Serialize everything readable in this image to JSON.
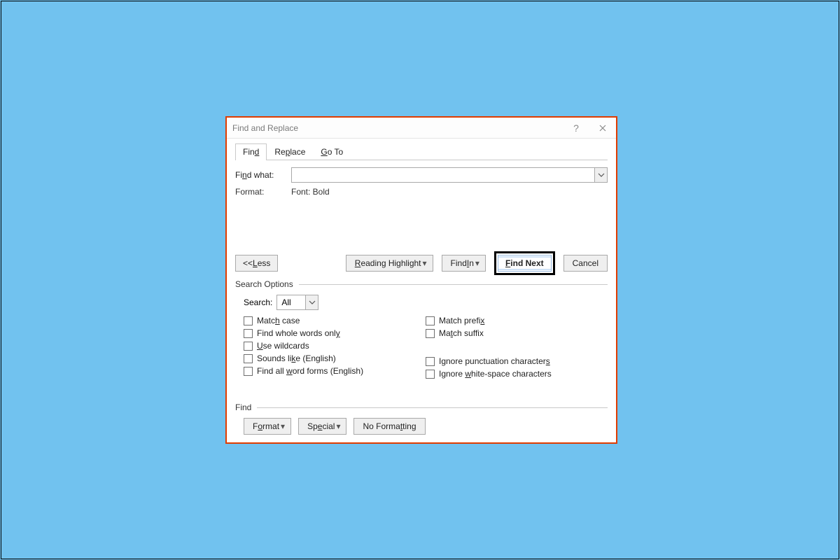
{
  "dialog": {
    "title": "Find and Replace"
  },
  "tabs": {
    "find": "Find",
    "replace": "Replace",
    "goto": "Go To"
  },
  "fields": {
    "find_what_label": "Find what:",
    "find_what_value": "",
    "format_label": "Format:",
    "format_value": "Font: Bold"
  },
  "buttons": {
    "less": "<< Less",
    "reading_highlight": "Reading Highlight",
    "find_in": "Find In",
    "find_next": "Find Next",
    "cancel": "Cancel",
    "format": "Format",
    "special": "Special",
    "no_formatting": "No Formatting"
  },
  "search_options": {
    "title": "Search Options",
    "search_label": "Search:",
    "search_value": "All",
    "match_case": "Match case",
    "find_whole_words": "Find whole words only",
    "use_wildcards": "Use wildcards",
    "sounds_like": "Sounds like (English)",
    "find_all_word_forms": "Find all word forms (English)",
    "match_prefix": "Match prefix",
    "match_suffix": "Match suffix",
    "ignore_punctuation": "Ignore punctuation characters",
    "ignore_whitespace": "Ignore white-space characters"
  },
  "find_section": {
    "title": "Find"
  }
}
